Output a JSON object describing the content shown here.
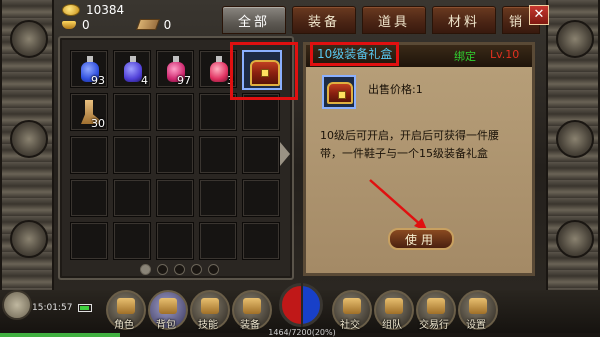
{
  "currency": {
    "coins": "10384",
    "gold_ingots": "0",
    "tickets": "0"
  },
  "tabs": [
    {
      "label": "全部",
      "active": true
    },
    {
      "label": "装备",
      "active": false
    },
    {
      "label": "道具",
      "active": false
    },
    {
      "label": "材料",
      "active": false
    },
    {
      "label": "销",
      "active": false
    }
  ],
  "close_label": "✕",
  "inventory": {
    "slots": [
      {
        "item": "blue-potion",
        "count": "93",
        "color": "#3050e0"
      },
      {
        "item": "blue-purple-potion",
        "count": "4",
        "color": "#5040d8"
      },
      {
        "item": "pink-potion",
        "count": "97",
        "color": "#d02870"
      },
      {
        "item": "red-pink-potion",
        "count": "3",
        "color": "#e03060"
      },
      {
        "item": "equipment-gift-box",
        "count": "",
        "selected": true
      },
      {
        "item": "boots",
        "count": "30"
      }
    ],
    "total_slots": 25,
    "pages": 5,
    "current_page": 1
  },
  "detail": {
    "name": "10级装备礼盒",
    "bind": "绑定",
    "level": "Lv.10",
    "price": "出售价格:1",
    "description": "10级后可开启，开启后可获得一件腰带，一件鞋子与一个15级装备礼盒",
    "use_label": "使用"
  },
  "status": {
    "time": "15:01:57"
  },
  "menu": [
    {
      "label": "角色",
      "icon": "character-icon"
    },
    {
      "label": "背包",
      "icon": "bag-icon",
      "active": true
    },
    {
      "label": "技能",
      "icon": "skills-icon"
    },
    {
      "label": "装备",
      "icon": "equipment-icon"
    },
    {
      "label": "社交",
      "icon": "social-icon"
    },
    {
      "label": "组队",
      "icon": "team-icon"
    },
    {
      "label": "交易行",
      "icon": "trade-icon"
    },
    {
      "label": "设置",
      "icon": "settings-icon"
    }
  ],
  "exp": {
    "text": "1464/7200(20%)",
    "fraction": 0.2
  }
}
